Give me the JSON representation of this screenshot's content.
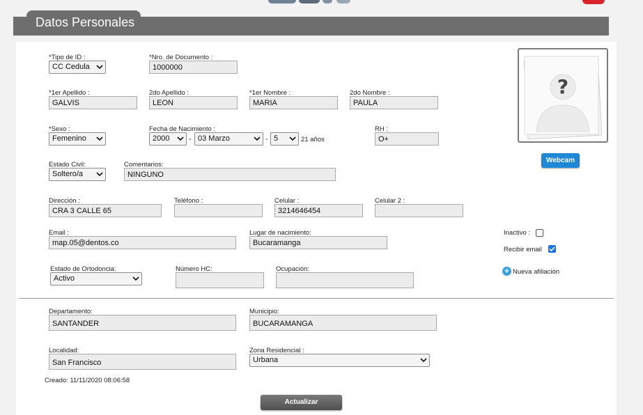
{
  "section_title": "Datos Personales",
  "fields": {
    "tipo_id": {
      "label": "*Tipo de ID :",
      "value": "CC Cedula"
    },
    "nro_documento": {
      "label": "*Nro. de Documento :",
      "value": "1000000"
    },
    "primer_apellido": {
      "label": "*1er Apellido :",
      "value": "GALVIS"
    },
    "segundo_apellido": {
      "label": "2do Apellido :",
      "value": "LEON"
    },
    "primer_nombre": {
      "label": "*1er Nombre :",
      "value": "MARIA"
    },
    "segundo_nombre": {
      "label": "2do Nombre :",
      "value": "PAULA"
    },
    "sexo": {
      "label": "*Sexo :",
      "value": "Femenino"
    },
    "fecha_nacimiento": {
      "label": "Fecha de Nacimiento :",
      "year": "2000",
      "month": "03 Marzo",
      "day": "5",
      "separator": "-",
      "age": "21 años"
    },
    "rh": {
      "label": "RH :",
      "value": "O+"
    },
    "estado_civil": {
      "label": "Estado Civil:",
      "value": "Soltero/a"
    },
    "comentarios": {
      "label": "Comentarios:",
      "value": "NINGUNO"
    },
    "direccion": {
      "label": "Dirección :",
      "value": "CRA 3 CALLE 65"
    },
    "telefono": {
      "label": "Teléfono :",
      "value": ""
    },
    "celular": {
      "label": "Celular :",
      "value": "3214646454"
    },
    "celular2": {
      "label": "Celular 2 :",
      "value": ""
    },
    "email": {
      "label": "Email :",
      "value": "map.05@dentos.co"
    },
    "lugar_nacimiento": {
      "label": "Lugar de nacimiento:",
      "value": "Bucaramanga"
    },
    "estado_ortodoncia": {
      "label": "Estado de Ortodoncia:",
      "value": "Activo"
    },
    "numero_hc": {
      "label": "Número HC:",
      "value": ""
    },
    "ocupacion": {
      "label": "Ocupación:",
      "value": ""
    },
    "departamento": {
      "label": "Departamento:",
      "value": "SANTANDER"
    },
    "municipio": {
      "label": "Municipio:",
      "value": "BUCARAMANGA"
    },
    "localidad": {
      "label": "Localidad:",
      "value": "San Francisco"
    },
    "zona_residencial": {
      "label": "Zona Residencial :",
      "value": "Urbana"
    }
  },
  "side": {
    "webcam_label": "Webcam",
    "inactivo_label": "Inactivo :",
    "inactivo_checked": false,
    "recibir_email_label": "Recibir email",
    "recibir_email_checked": true,
    "nueva_afiliacion_label": "Nueva afiliación",
    "photo_placeholder": "?"
  },
  "footer": {
    "created_text": "Creado: 11/11/2020 08:06:58",
    "update_button": "Actualizar"
  },
  "colors": {
    "header": "#6e6e6e",
    "accent_blue": "#1e88d6",
    "button_gray": "#5f5f5f"
  }
}
